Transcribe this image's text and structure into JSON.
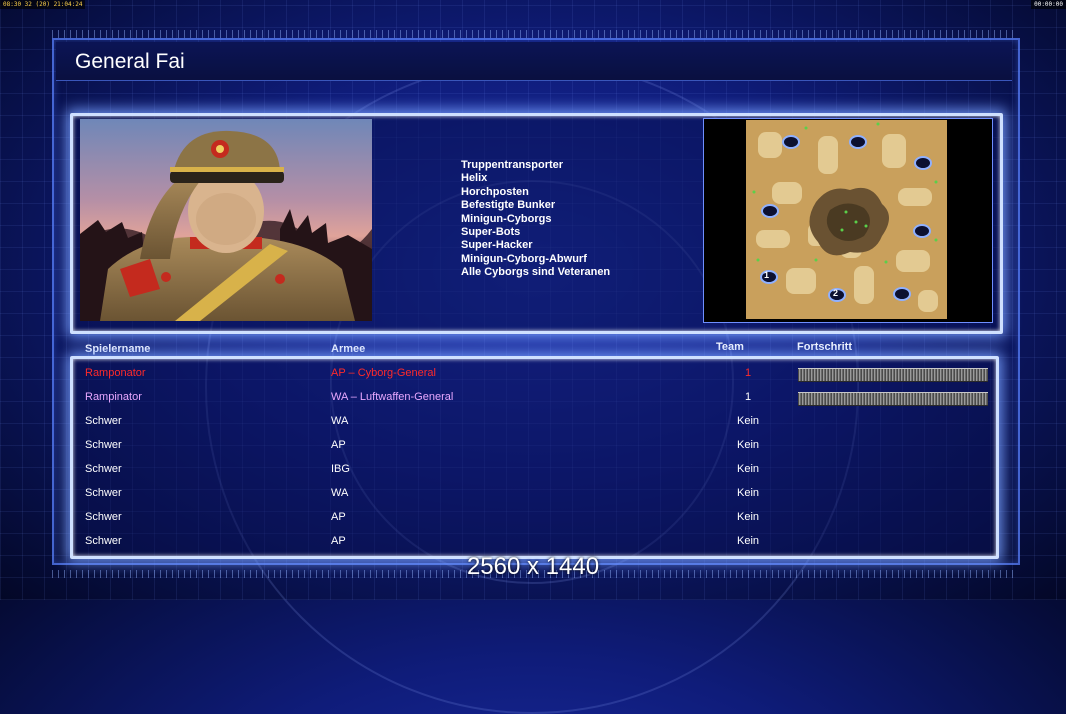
{
  "hud": {
    "time_left": "08:30 32 (20) 21:04:24",
    "time_right": "00:00:00"
  },
  "general": {
    "title": "General Fai"
  },
  "features": [
    "Truppentransporter",
    "Helix",
    "Horchposten",
    "Befestigte Bunker",
    "Minigun-Cyborgs",
    "Super-Bots",
    "Super-Hacker",
    "Minigun-Cyborg-Abwurf",
    "Alle Cyborgs sind Veteranen"
  ],
  "minimap": {
    "start_labels": [
      "1",
      "2"
    ]
  },
  "table": {
    "headers": {
      "player": "Spielername",
      "army": "Armee",
      "team": "Team",
      "progress": "Fortschritt"
    },
    "rows": [
      {
        "name": "Ramponator",
        "army": "AP – Cyborg-General",
        "team": "1",
        "color": "#ff2a2a",
        "progress": 1.0
      },
      {
        "name": "Rampinator",
        "army": "WA – Luftwaffen-General",
        "team": "1",
        "color": "#e8a8ff",
        "progress": 1.0
      },
      {
        "name": "Schwer",
        "army": "WA",
        "team": "Kein",
        "color": "#ffffff"
      },
      {
        "name": "Schwer",
        "army": "AP",
        "team": "Kein",
        "color": "#ffffff"
      },
      {
        "name": "Schwer",
        "army": "IBG",
        "team": "Kein",
        "color": "#ffffff"
      },
      {
        "name": "Schwer",
        "army": "WA",
        "team": "Kein",
        "color": "#ffffff"
      },
      {
        "name": "Schwer",
        "army": "AP",
        "team": "Kein",
        "color": "#ffffff"
      },
      {
        "name": "Schwer",
        "army": "AP",
        "team": "Kein",
        "color": "#ffffff"
      }
    ]
  },
  "watermark": "2560 x 1440"
}
